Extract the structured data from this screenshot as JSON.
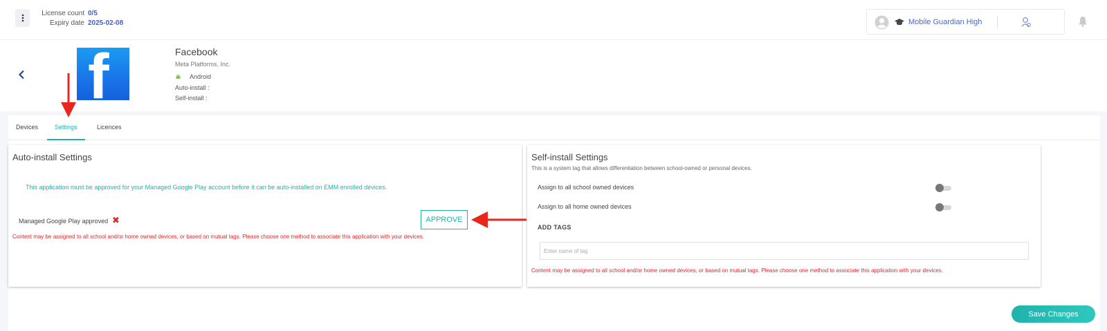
{
  "header": {
    "license_label": "License count",
    "license_value": "0/5",
    "expiry_label": "Expiry date",
    "expiry_value": "2025-02-08",
    "school_name": "Mobile Guardian High"
  },
  "app": {
    "name": "Facebook",
    "vendor": "Meta Platforms, Inc.",
    "logo_letter": "f",
    "platform": "Android",
    "auto_install_label": "Auto-install :",
    "self_install_label": "Self-install :"
  },
  "tabs": [
    {
      "label": "Devices",
      "active": false
    },
    {
      "label": "Settings",
      "active": true
    },
    {
      "label": "Licences",
      "active": false
    }
  ],
  "auto_install": {
    "title": "Auto-install Settings",
    "info": "This application must be approved for your Managed Google Play account before it can be auto-installed on EMM enrolled devices.",
    "approved_label": "Managed Google Play approved",
    "approve_button": "APPROVE",
    "error": "Content may be assigned to all school and/or home owned devices, or based on mutual tags. Please choose one method to associate this application with your devices."
  },
  "self_install": {
    "title": "Self-install Settings",
    "subtitle": "This is a system tag that allows differentiation between school-owned or personal devices.",
    "school_toggle_label": "Assign to all school owned devices",
    "school_toggle_on": false,
    "home_toggle_label": "Assign to all home owned devices",
    "home_toggle_on": false,
    "add_tags_label": "ADD TAGS",
    "tag_placeholder": "Enter name of tag",
    "error": "Content may be assigned to all school and/or home owned devices, or based on mutual tags. Please choose one method to associate this application with your devices."
  },
  "footer": {
    "save_button": "Save Changes"
  },
  "colors": {
    "accent": "#1fb3ac",
    "error": "#e0262a",
    "link_blue": "#3f5fd6",
    "annotation": "#e8261c"
  }
}
